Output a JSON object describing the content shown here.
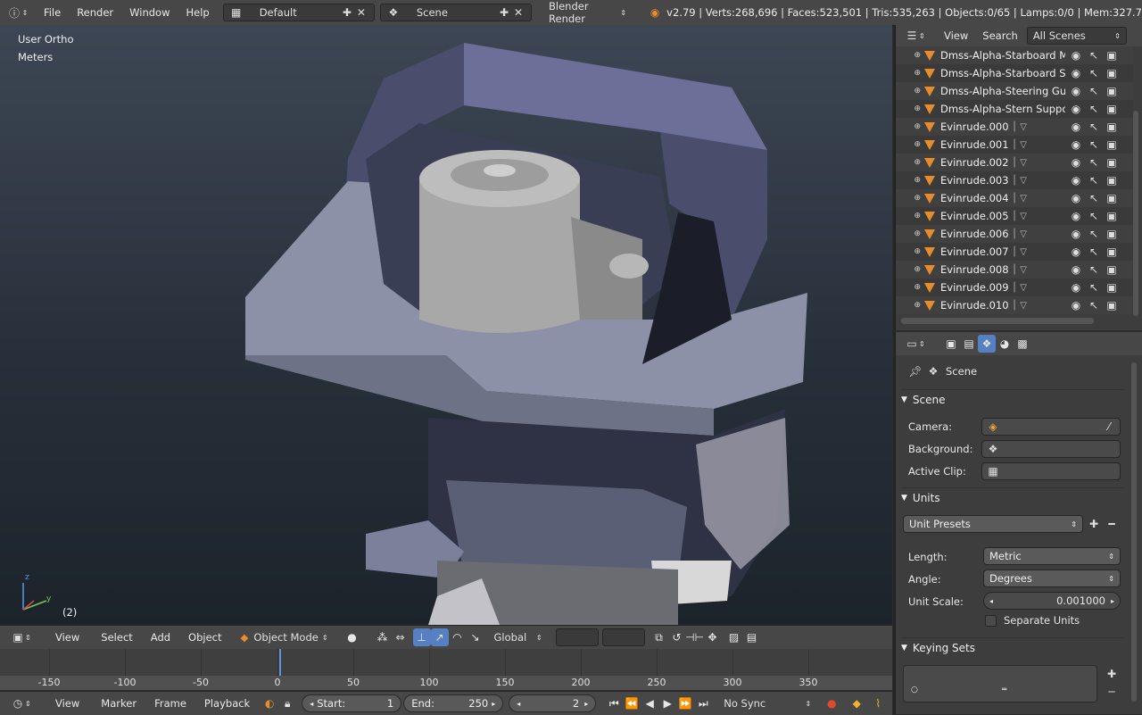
{
  "topbar": {
    "menus": [
      "File",
      "Render",
      "Window",
      "Help"
    ],
    "layout": "Default",
    "scene": "Scene",
    "engine": "Blender Render",
    "stats": "v2.79 | Verts:268,696 | Faces:523,501 | Tris:535,263 | Objects:0/65 | Lamps:0/0 | Mem:327.7"
  },
  "viewport": {
    "view_label": "User Ortho",
    "units_label": "Meters",
    "frame_label": "(2)",
    "axis_z": "z",
    "axis_y": "y"
  },
  "vp_header": {
    "menus": [
      "View",
      "Select",
      "Add",
      "Object"
    ],
    "mode": "Object Mode",
    "orientation": "Global"
  },
  "timeline": {
    "ticks": [
      "-150",
      "-100",
      "-50",
      "0",
      "50",
      "100",
      "150",
      "200",
      "250",
      "300",
      "350"
    ],
    "current_frame": 2
  },
  "bottombar": {
    "menus": [
      "View",
      "Marker",
      "Frame",
      "Playback"
    ],
    "start_label": "Start:",
    "start_value": "1",
    "end_label": "End:",
    "end_value": "250",
    "current": "2",
    "sync": "No Sync"
  },
  "outliner": {
    "header": [
      "View",
      "Search"
    ],
    "filter": "All Scenes",
    "items": [
      "Dmss-Alpha-Starboard Moto",
      "Dmss-Alpha-Starboard Stern",
      "Dmss-Alpha-Steering Guide",
      "Dmss-Alpha-Stern Support",
      "Evinrude.000",
      "Evinrude.001",
      "Evinrude.002",
      "Evinrude.003",
      "Evinrude.004",
      "Evinrude.005",
      "Evinrude.006",
      "Evinrude.007",
      "Evinrude.008",
      "Evinrude.009",
      "Evinrude.010"
    ]
  },
  "properties": {
    "context": "Scene",
    "scene_panel": {
      "title": "Scene",
      "camera_label": "Camera:",
      "background_label": "Background:",
      "clip_label": "Active Clip:"
    },
    "units_panel": {
      "title": "Units",
      "presets": "Unit Presets",
      "length_label": "Length:",
      "length_value": "Metric",
      "angle_label": "Angle:",
      "angle_value": "Degrees",
      "scale_label": "Unit Scale:",
      "scale_value": "0.001000",
      "separate_label": "Separate Units"
    },
    "keying_panel": {
      "title": "Keying Sets"
    }
  },
  "colors": {
    "accent": "#5680c2",
    "object_icon": "#e78b2c",
    "panel_bg": "#3d3d3d",
    "header_bg": "#474747"
  }
}
